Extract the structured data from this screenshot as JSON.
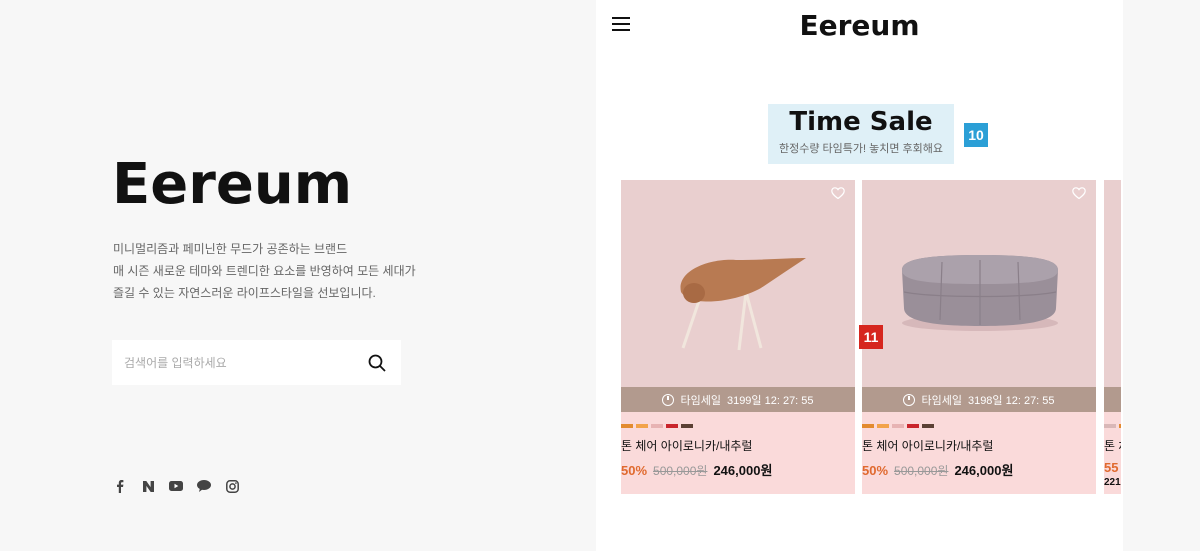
{
  "left": {
    "brand": "Eereum",
    "description": [
      "미니멀리즘과 페미닌한 무드가 공존하는 브랜드",
      "매 시즌 새로운 테마와 트렌디한 요소를 반영하여 모든 세대가",
      "즐길 수 있는 자연스러운 라이프스타일을 선보입니다."
    ],
    "search": {
      "placeholder": "검색어를 입력하세요",
      "icon": "search-icon"
    },
    "social": [
      "facebook-icon",
      "naver-icon",
      "youtube-icon",
      "talk-icon",
      "instagram-icon"
    ]
  },
  "mobile": {
    "logo": "Eereum",
    "menu_icon": "hamburger-icon",
    "time_sale": {
      "title": "Time Sale",
      "subtitle": "한정수량 타임특가! 놓치면 후회해요",
      "badge": "10"
    },
    "badge_product": "11",
    "products": [
      {
        "timer_label": "타임세일",
        "timer_value": "3199일 12: 27: 55",
        "name": "톤 체어 아이로니카/내추럴",
        "discount": "50%",
        "original_price": "500,000원",
        "price": "246,000원",
        "swatches": [
          "#e38b2f",
          "#f2a34a",
          "#e7b3b3",
          "#c9252c",
          "#5b4034"
        ]
      },
      {
        "timer_label": "타임세일",
        "timer_value": "3198일 12: 27: 55",
        "name": "톤 체어 아이로니카/내추럴",
        "discount": "50%",
        "original_price": "500,000원",
        "price": "246,000원",
        "swatches": [
          "#e38b2f",
          "#f2a34a",
          "#e7b3b3",
          "#c9252c",
          "#5b4034"
        ]
      },
      {
        "name": "톤 체",
        "discount": "55",
        "price": "221"
      }
    ]
  },
  "colors": {
    "accent_discount": "#e06a2f",
    "card_bg": "#fadada",
    "timer_bg": "#b29a8e",
    "badge_blue": "#2b9fd6",
    "badge_red": "#d6261e"
  }
}
